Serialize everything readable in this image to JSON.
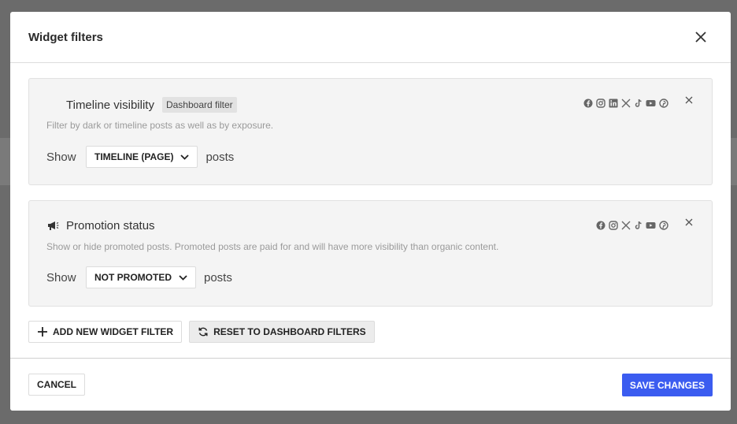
{
  "modal": {
    "title": "Widget filters"
  },
  "filters": [
    {
      "title": "Timeline visibility",
      "badge": "Dashboard filter",
      "description": "Filter by dark or timeline posts as well as by exposure.",
      "show_label": "Show",
      "selected_value": "TIMELINE (PAGE)",
      "posts_label": "posts",
      "networks": [
        "facebook-icon",
        "instagram-icon",
        "linkedin-icon",
        "x-icon",
        "tiktok-icon",
        "youtube-icon",
        "pinterest-icon"
      ]
    },
    {
      "title": "Promotion status",
      "description": "Show or hide promoted posts. Promoted posts are paid for and will have more visibility than organic content.",
      "show_label": "Show",
      "selected_value": "NOT PROMOTED",
      "posts_label": "posts",
      "networks": [
        "facebook-icon",
        "instagram-icon",
        "x-icon",
        "tiktok-icon",
        "youtube-icon",
        "pinterest-icon"
      ]
    }
  ],
  "actions": {
    "add_filter": "ADD NEW WIDGET FILTER",
    "reset_filters": "RESET TO DASHBOARD FILTERS"
  },
  "footer": {
    "cancel": "CANCEL",
    "save": "SAVE CHANGES"
  },
  "colors": {
    "primary": "#3b5cf0",
    "overlay": "#6b6b6b",
    "card_bg": "#f4f4f4"
  }
}
